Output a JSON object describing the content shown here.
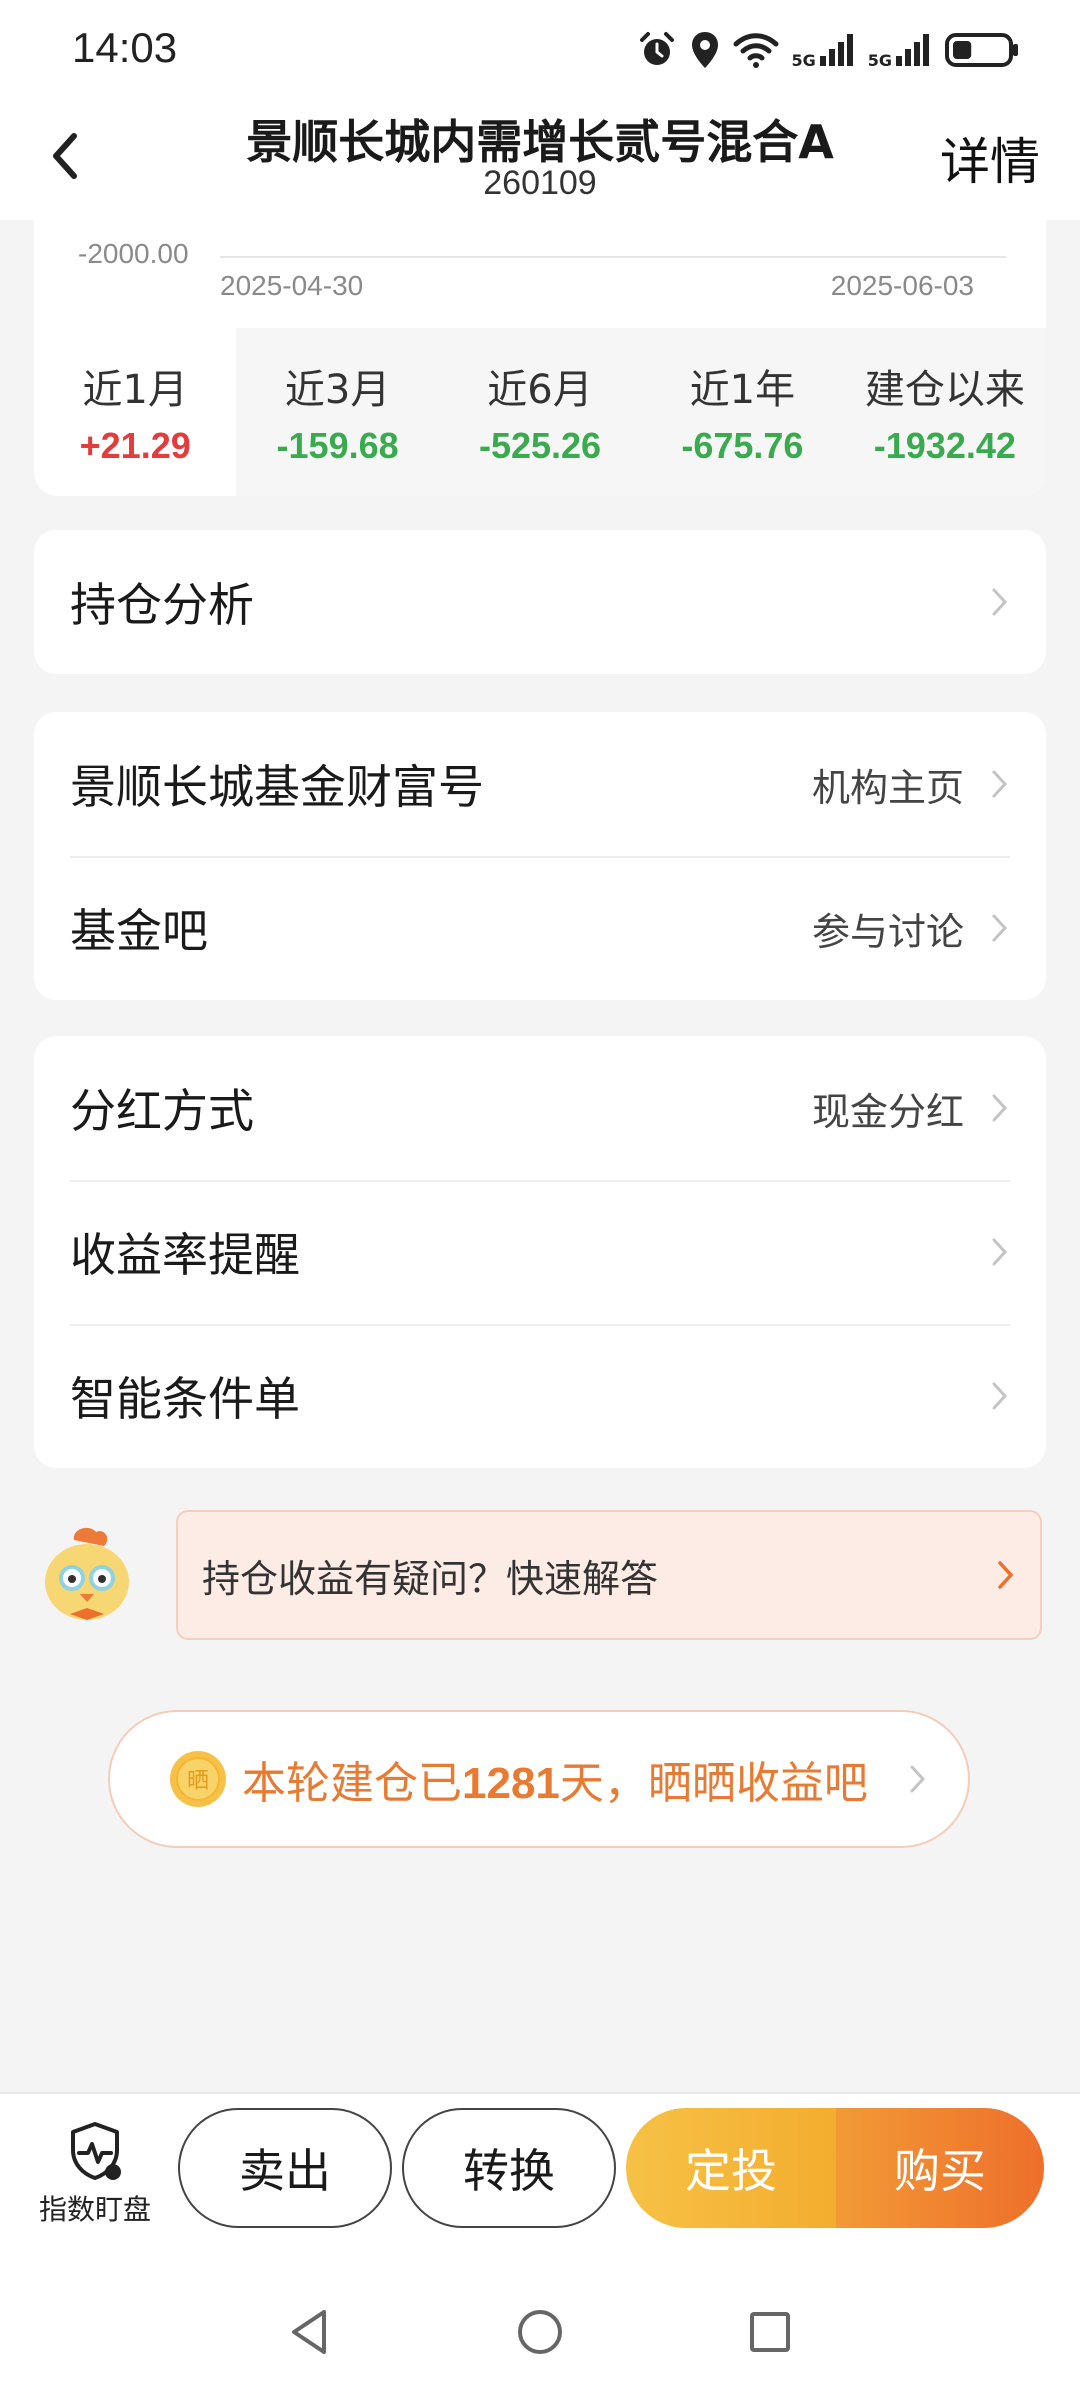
{
  "status_bar": {
    "time": "14:03",
    "icons": [
      "alarm-icon",
      "location-icon",
      "wifi-icon",
      "signal-5g-icon",
      "signal-5g-icon",
      "battery-icon"
    ],
    "network_labels": [
      "5G",
      "5G"
    ],
    "battery_level": 0.35
  },
  "header": {
    "title": "景顺长城内需增长贰号混合A",
    "code": "260109",
    "detail_label": "详情",
    "back_icon": "chevron-left-icon"
  },
  "chart": {
    "y_label": "-2000.00",
    "start_date": "2025-04-30",
    "end_date": "2025-06-03"
  },
  "periods": [
    {
      "label": "近1月",
      "value": "+21.29",
      "trend": "up"
    },
    {
      "label": "近3月",
      "value": "-159.68",
      "trend": "down"
    },
    {
      "label": "近6月",
      "value": "-525.26",
      "trend": "down"
    },
    {
      "label": "近1年",
      "value": "-675.76",
      "trend": "down"
    },
    {
      "label": "建仓以来",
      "value": "-1932.42",
      "trend": "down"
    }
  ],
  "holdings_card": {
    "label": "持仓分析"
  },
  "community_card": {
    "wealth": {
      "label": "景顺长城基金财富号",
      "value": "机构主页"
    },
    "forum": {
      "label": "基金吧",
      "value": "参与讨论"
    }
  },
  "settings_card": {
    "dividend": {
      "label": "分红方式",
      "value": "现金分红"
    },
    "alert": {
      "label": "收益率提醒"
    },
    "smart": {
      "label": "智能条件单"
    }
  },
  "faq": {
    "text": "持仓收益有疑问？快速解答"
  },
  "holding_days": {
    "prefix": "本轮建仓已",
    "days": "1281",
    "suffix": "天，晒晒收益吧",
    "coin_char": "晒"
  },
  "bottom_bar": {
    "monitor_label": "指数盯盘",
    "sell": "卖出",
    "convert": "转换",
    "invest": "定投",
    "buy": "购买"
  },
  "colors": {
    "up": "#e43b3b",
    "down": "#3aaa4e",
    "accent_orange": "#ee6f2b",
    "accent_yellow": "#f6c146"
  }
}
